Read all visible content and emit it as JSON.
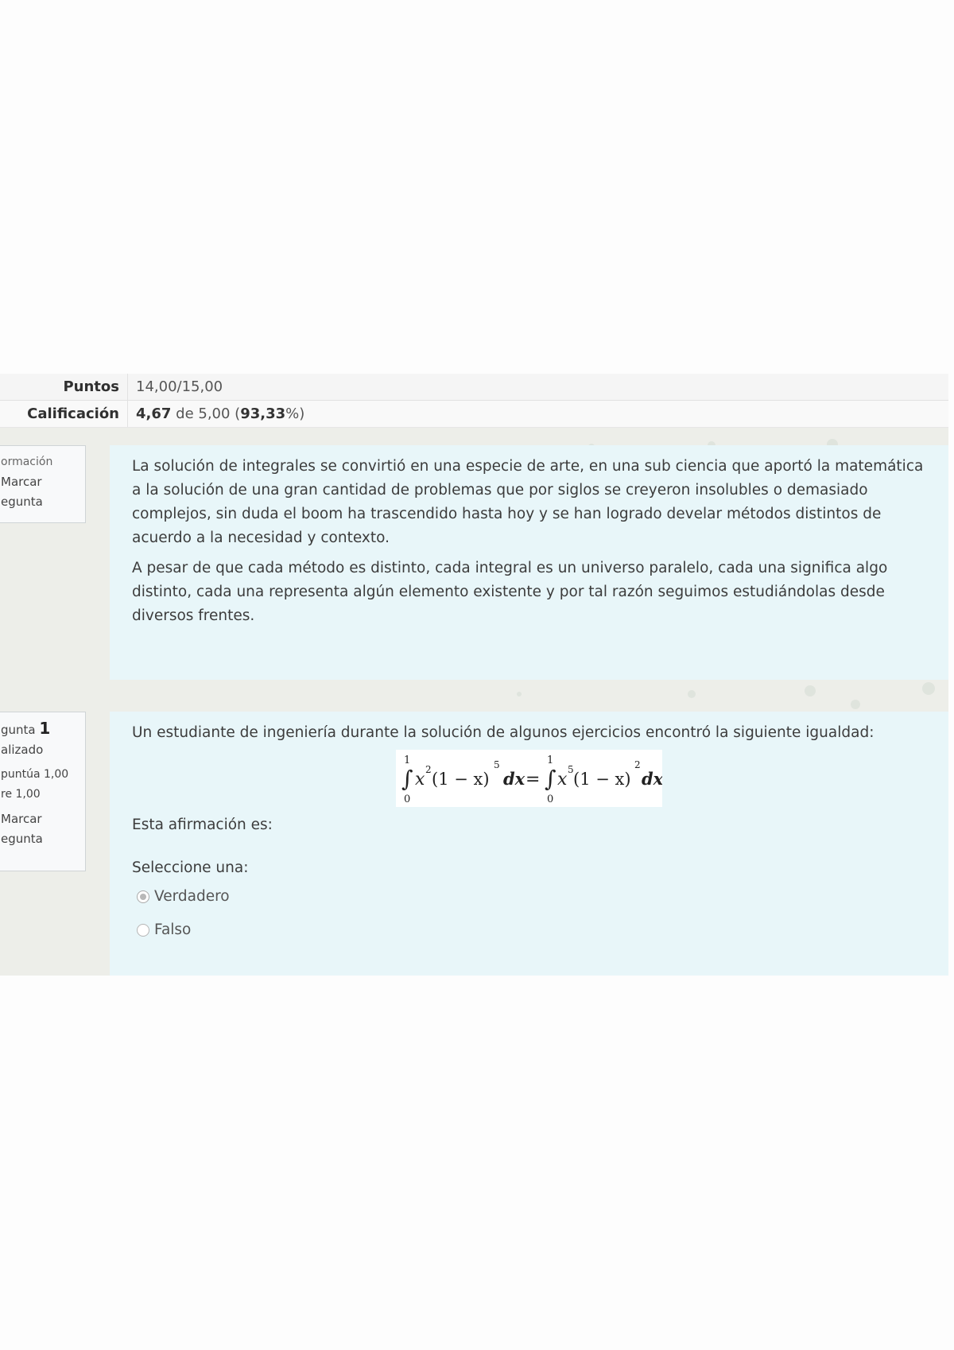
{
  "summary": {
    "points_label": "Puntos",
    "points_value": "14,00/15,00",
    "grade_label": "Calificación",
    "grade_bold": "4,67",
    "grade_mid": " de 5,00 (",
    "grade_percent": "93,33",
    "grade_end": "%)"
  },
  "info_block": {
    "status": "ormación",
    "flag_line1": "Marcar",
    "flag_line2": "egunta",
    "paragraphs": [
      "La solución de integrales se convirtió en una especie de arte, en una sub ciencia que aportó la matemática a la solución de una gran cantidad de problemas que por siglos se creyeron insolubles o demasiado complejos, sin duda el boom ha trascendido hasta hoy y se han logrado develar métodos distintos de acuerdo a la necesidad y contexto.",
      "A pesar de que cada método es distinto, cada integral es un universo paralelo, cada una significa algo distinto, cada una representa algún elemento existente y por tal razón seguimos estudiándolas desde diversos frentes."
    ]
  },
  "question": {
    "label": "gunta",
    "number": "1",
    "state": "alizado",
    "score_line1": "puntúa 1,00",
    "score_line2": "re 1,00",
    "flag_line1": "Marcar",
    "flag_line2": "egunta",
    "text": "Un estudiante de ingeniería durante la solución de algunos ejercicios encontró la siguiente igualdad:",
    "statement": "Esta afirmación es:",
    "select_prompt": "Seleccione una:",
    "options": [
      {
        "label": "Verdadero",
        "checked": true
      },
      {
        "label": "Falso",
        "checked": false
      }
    ]
  },
  "formula": {
    "int_lower": "0",
    "int_upper": "1",
    "int_sign": "∫",
    "left_x": "x",
    "left_x_exp": "2",
    "left_paren": "(1 − x)",
    "left_paren_exp": "5",
    "dx": "dx",
    "equals": "=",
    "right_x": "x",
    "right_x_exp": "5",
    "right_paren": "(1 − x)",
    "right_paren_exp": "2"
  },
  "colors": {
    "panel_bg": "#e8f6f9",
    "page_bg": "#edeee9",
    "summary_bg": "#f5f5f5"
  }
}
